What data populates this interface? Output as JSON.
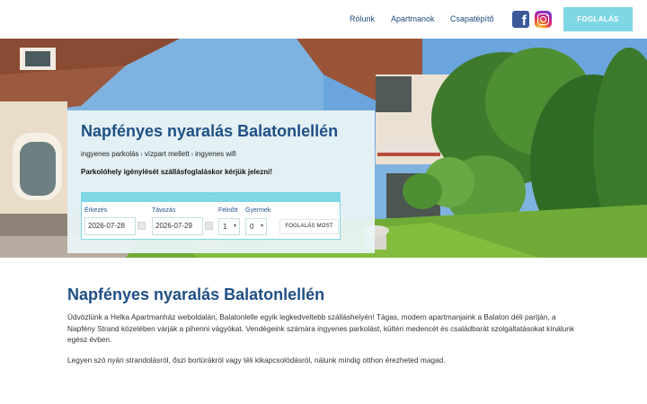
{
  "nav": {
    "items": [
      "Rólunk",
      "Apartmanok",
      "Csapatépítő"
    ],
    "cta": "FOGLALÁS"
  },
  "hero": {
    "title": "Napfényes nyaralás Balatonlellén",
    "features": [
      "ingyenes parkolás",
      "vízpart mellett",
      "ingyenes wifi"
    ],
    "feature_sep": "ı",
    "note": "Parkolóhely igénylését szállásfoglaláskor kérjük jelezni!"
  },
  "booking": {
    "bar_text": "-",
    "arrival_label": "Érkezés",
    "arrival_value": "2026-07-28",
    "departure_label": "Távozás",
    "departure_value": "2026-07-29",
    "adults_label": "Felnőtt",
    "adults_value": "1",
    "children_label": "Gyermek",
    "children_value": "0",
    "submit": "FOGLALÁS MOST"
  },
  "content": {
    "title": "Napfényes nyaralás Balatonlellén",
    "paragraph1": "Üdvözlünk a Helka Apartmanház weboldalán, Balatonlelle egyik legkedveltebb szálláshelyén! Tágas, modern apartmanjaink a Balaton déli partján, a Napfény Strand közelében várják a pihenni vágyókat. Vendégeink számára ingyenes parkolást, kültéri medencét és családbarát szolgáltatásokat kínálunk egész évben.",
    "paragraph2": "Legyen szó nyári strandolásról, őszi bortúrákról vagy téli kikapcsolódásról, nálunk mindig otthon érezheted magad."
  },
  "colors": {
    "primary": "#1f4f85",
    "accent": "#7fd6e4",
    "facebook": "#3b5998"
  },
  "icons": {
    "facebook": "facebook-icon",
    "instagram": "instagram-icon"
  }
}
